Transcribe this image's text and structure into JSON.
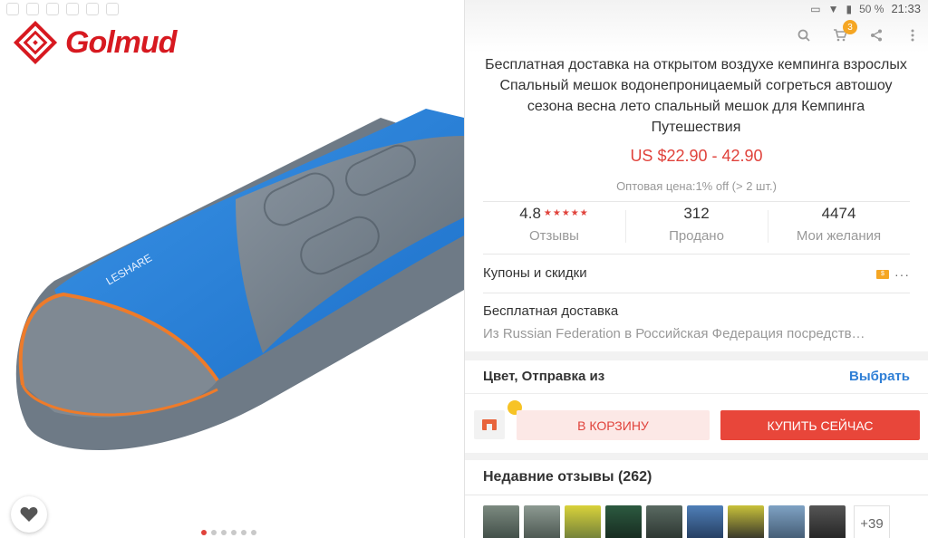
{
  "brand": {
    "name": "Golmud"
  },
  "colors": {
    "accent": "#e0423b",
    "link": "#2f7fd6",
    "badge": "#f5a623",
    "brand_red": "#d71920"
  },
  "status": {
    "battery": "50 %",
    "time": "21:33"
  },
  "toolbar": {
    "cart_count": "3"
  },
  "product": {
    "title": "Бесплатная доставка на открытом воздухе кемпинга взрослых Спальный мешок водонепроницаемый согреться автошоу сезона весна лето спальный мешок для Кемпинга Путешествия",
    "price": "US $22.90 - 42.90",
    "wholesale": "Оптовая цена:1% off (> 2 шт.)"
  },
  "stats": [
    {
      "value": "4.8",
      "stars": "★★★★★",
      "label": "Отзывы"
    },
    {
      "value": "312",
      "label": "Продано"
    },
    {
      "value": "4474",
      "label": "Мои желания"
    }
  ],
  "coupons": {
    "label": "Купоны и скидки",
    "tag": "$",
    "more": "···"
  },
  "shipping": {
    "label": "Бесплатная доставка",
    "detail": "Из Russian Federation в Российская Федерация посредств…"
  },
  "options": {
    "label": "Цвет, Отправка из",
    "action": "Выбрать"
  },
  "buttons": {
    "cart": "В КОРЗИНУ",
    "buy": "КУПИТЬ СЕЙЧАС"
  },
  "reviews": {
    "title": "Недавние отзывы (262)",
    "more": "+39"
  },
  "gallery": {
    "image_count": 6,
    "active_index": 0
  },
  "icons": [
    "search-icon",
    "cart-icon",
    "share-icon",
    "overflow-menu-icon",
    "heart-icon",
    "store-icon",
    "wifi-icon",
    "battery-icon"
  ]
}
